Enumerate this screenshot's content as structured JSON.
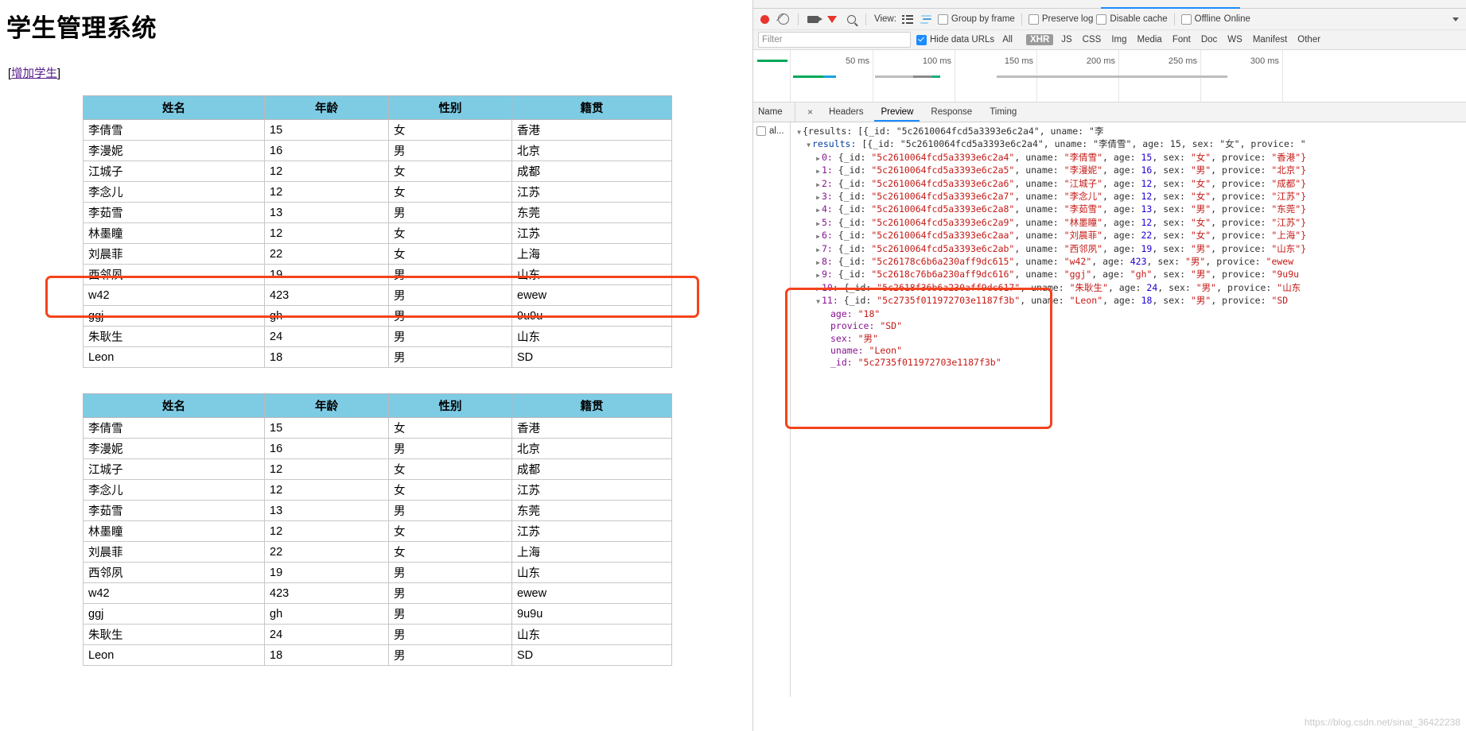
{
  "webpage": {
    "title": "学生管理系统",
    "add_link_prefix": "[",
    "add_link_label": "增加学生",
    "add_link_suffix": "]",
    "columns": [
      "姓名",
      "年龄",
      "性别",
      "籍贯"
    ],
    "rows": [
      [
        "李倩雪",
        "15",
        "女",
        "香港"
      ],
      [
        "李漫妮",
        "16",
        "男",
        "北京"
      ],
      [
        "江城子",
        "12",
        "女",
        "成都"
      ],
      [
        "李念儿",
        "12",
        "女",
        "江苏"
      ],
      [
        "李茹雪",
        "13",
        "男",
        "东莞"
      ],
      [
        "林墨瞳",
        "12",
        "女",
        "江苏"
      ],
      [
        "刘晨菲",
        "22",
        "女",
        "上海"
      ],
      [
        "西邻夙",
        "19",
        "男",
        "山东"
      ],
      [
        "w42",
        "423",
        "男",
        "ewew"
      ],
      [
        "ggj",
        "gh",
        "男",
        "9u9u"
      ],
      [
        "朱耿生",
        "24",
        "男",
        "山东"
      ],
      [
        "Leon",
        "18",
        "男",
        "SD"
      ]
    ],
    "header_bg": "#7ecbe4",
    "annotation_color": "#f4431c"
  },
  "devtools": {
    "toolbar": {
      "record_icon": "record-dot-icon",
      "clear_icon": "clear-icon",
      "camera_icon": "filmstrip-camera-icon",
      "filter_icon": "funnel-filter-icon",
      "search_icon": "search-icon",
      "view_label": "View:",
      "view_list_icon": "list-view-icon",
      "view_waterfall_icon": "waterfall-view-icon",
      "group_by_frame": "Group by frame",
      "preserve_log": "Preserve log",
      "disable_cache": "Disable cache",
      "offline": "Offline",
      "throttling_value": "Online",
      "throttling_caret": "chevron-down-icon"
    },
    "filterbar": {
      "filter_placeholder": "Filter",
      "filter_value": "",
      "hide_data_urls": "Hide data URLs",
      "types": [
        "All",
        "XHR",
        "JS",
        "CSS",
        "Img",
        "Media",
        "Font",
        "Doc",
        "WS",
        "Manifest",
        "Other"
      ],
      "selected_type": "XHR"
    },
    "timeline": {
      "ticks": [
        "50 ms",
        "100 ms",
        "150 ms",
        "200 ms",
        "250 ms",
        "300 ms"
      ]
    },
    "subtabs": {
      "name_col": "Name",
      "close": "×",
      "tabs": [
        "Headers",
        "Preview",
        "Response",
        "Timing"
      ],
      "active": "Preview"
    },
    "namelist": [
      {
        "label": "al..."
      }
    ],
    "preview": {
      "root_line": "{results: [{_id: \"5c2610064fcd5a3393e6c2a4\", uname: \"李",
      "results_line": "results: [{_id: \"5c2610064fcd5a3393e6c2a4\", uname: \"李倩雪\", age: 15, sex: \"女\", provice: \"",
      "items": [
        {
          "index": "0",
          "id": "5c2610064fcd5a3393e6c2a4",
          "uname": "李倩雪",
          "age": "15",
          "sex": "女",
          "provice": "香港\"}"
        },
        {
          "index": "1",
          "id": "5c2610064fcd5a3393e6c2a5",
          "uname": "李漫妮",
          "age": "16",
          "sex": "男",
          "provice": "北京\"}"
        },
        {
          "index": "2",
          "id": "5c2610064fcd5a3393e6c2a6",
          "uname": "江城子",
          "age": "12",
          "sex": "女",
          "provice": "成都\"}"
        },
        {
          "index": "3",
          "id": "5c2610064fcd5a3393e6c2a7",
          "uname": "李念儿",
          "age": "12",
          "sex": "女",
          "provice": "江苏\"}"
        },
        {
          "index": "4",
          "id": "5c2610064fcd5a3393e6c2a8",
          "uname": "李茹雪",
          "age": "13",
          "sex": "男",
          "provice": "东莞\"}"
        },
        {
          "index": "5",
          "id": "5c2610064fcd5a3393e6c2a9",
          "uname": "林墨瞳",
          "age": "12",
          "sex": "女",
          "provice": "江苏\"}"
        },
        {
          "index": "6",
          "id": "5c2610064fcd5a3393e6c2aa",
          "uname": "刘晨菲",
          "age": "22",
          "sex": "女",
          "provice": "上海\"}"
        },
        {
          "index": "7",
          "id": "5c2610064fcd5a3393e6c2ab",
          "uname": "西邻夙",
          "age": "19",
          "sex": "男",
          "provice": "山东\"}"
        },
        {
          "index": "8",
          "id": "5c26178c6b6a230aff9dc615",
          "uname": "w42",
          "age": "423",
          "sex": "男",
          "provice": "ewew"
        },
        {
          "index": "9",
          "id": "5c2618c76b6a230aff9dc616",
          "uname": "ggj",
          "age": "gh",
          "sex": "男",
          "provice": "9u9u"
        },
        {
          "index": "10",
          "id": "5c2618f36b6a230aff9dc617",
          "uname": "朱耿生",
          "age": "24",
          "sex": "男",
          "provice": "山东"
        },
        {
          "index": "11",
          "id": "5c2735f011972703e1187f3b",
          "uname": "Leon",
          "age": "18",
          "sex": "男",
          "provice": "SD"
        }
      ],
      "expanded_detail": {
        "age_key": "age:",
        "age_val": "\"18\"",
        "provice_key": "provice:",
        "provice_val": "\"SD\"",
        "sex_key": "sex:",
        "sex_val": "\"男\"",
        "uname_key": "uname:",
        "uname_val": "\"Leon\"",
        "id_key": "_id:",
        "id_val": "\"5c2735f011972703e1187f3b\""
      }
    }
  },
  "watermark": "https://blog.csdn.net/sinat_36422238"
}
